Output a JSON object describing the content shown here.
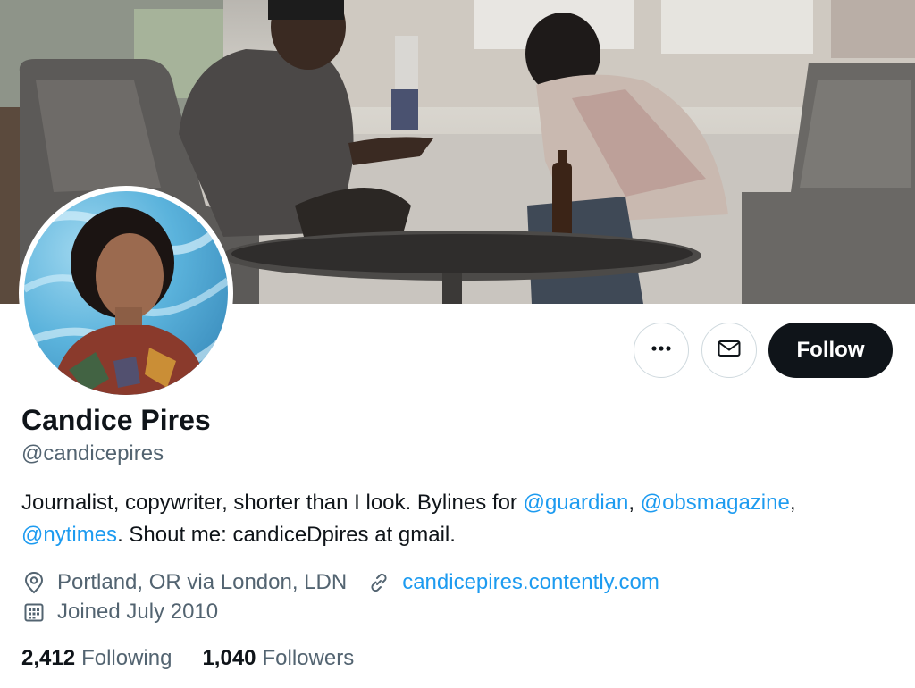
{
  "profile": {
    "name": "Candice Pires",
    "handle": "@candicepires",
    "bio": {
      "part1": "Journalist, copywriter, shorter than I look. Bylines for ",
      "mention1": "@guardian",
      "sep1": ", ",
      "mention2": "@obsmagazine",
      "sep2": ",",
      "mention3": "@nytimes",
      "part2": ". Shout me: candiceDpires at gmail."
    },
    "location": "Portland, OR via London, LDN",
    "website": "candicepires.contently.com",
    "joined": "Joined July 2010"
  },
  "actions": {
    "more_icon": "more-horizontal-icon",
    "message_icon": "envelope-icon",
    "follow_label": "Follow"
  },
  "stats": {
    "following_count": "2,412",
    "following_label": "Following",
    "followers_count": "1,040",
    "followers_label": "Followers"
  },
  "colors": {
    "link": "#1d9bf0",
    "primary_text": "#0f1419",
    "secondary_text": "#536471",
    "follow_button": "#0f1419"
  }
}
